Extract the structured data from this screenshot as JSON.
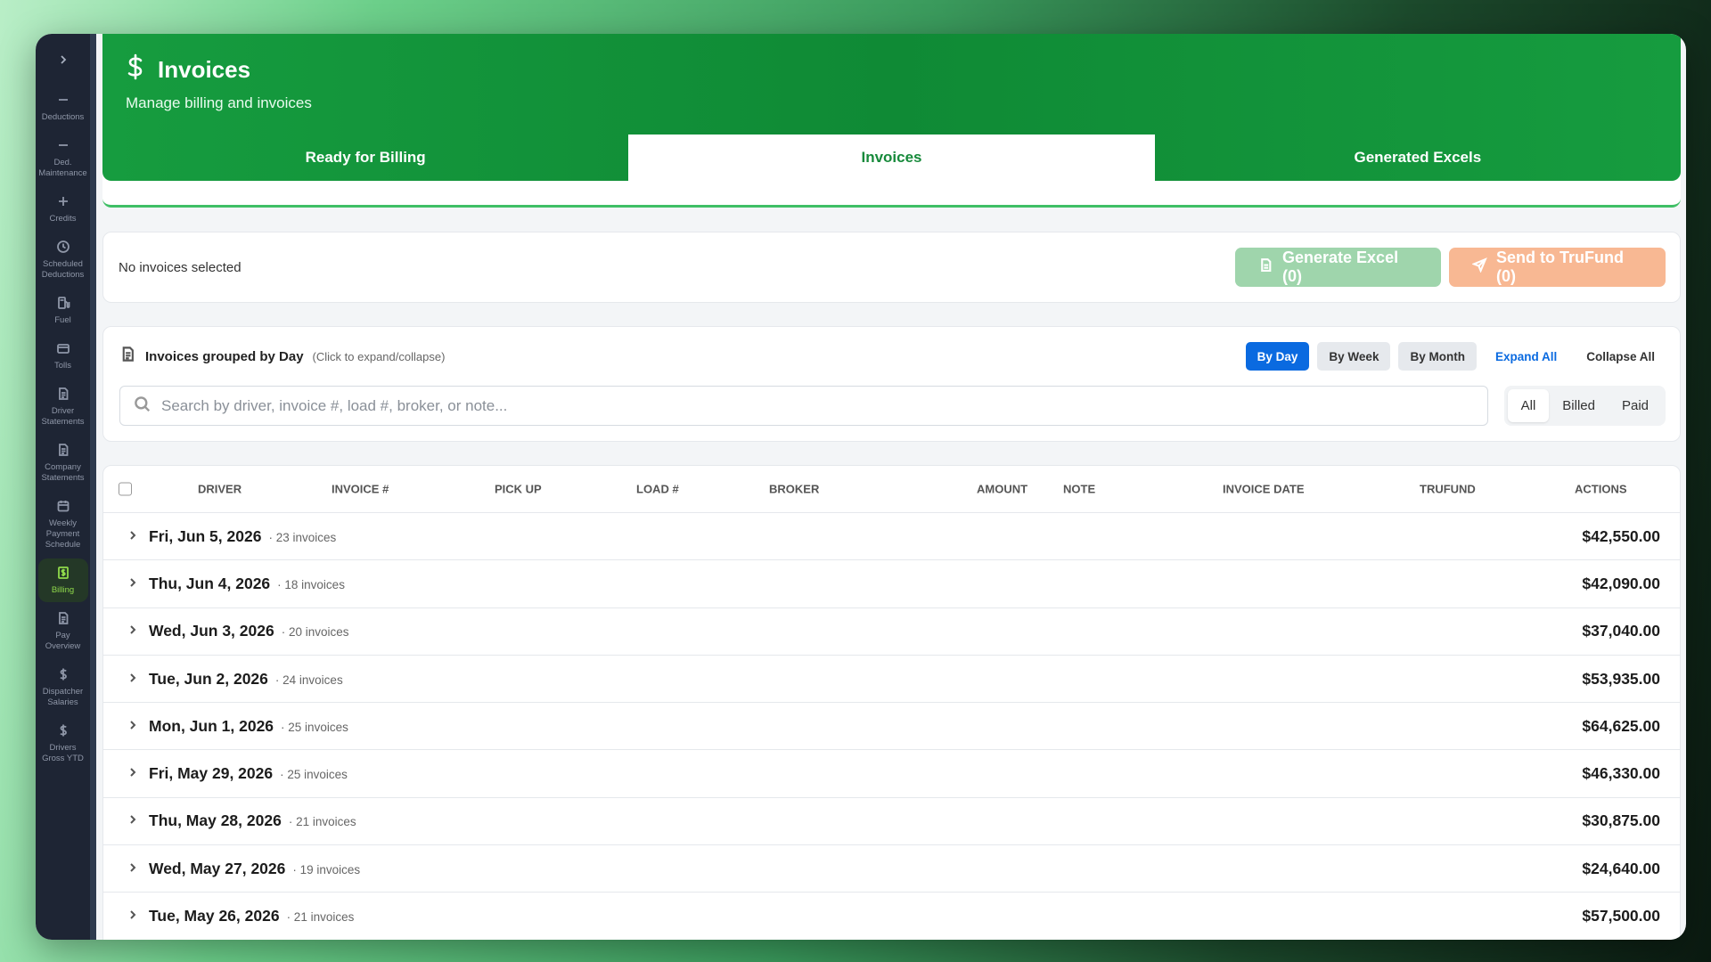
{
  "sidebar": {
    "items": [
      {
        "label": "Deductions",
        "icon": "minus-icon"
      },
      {
        "label": "Ded. Maintenance",
        "icon": "minus-icon"
      },
      {
        "label": "Credits",
        "icon": "plus-icon"
      },
      {
        "label": "Scheduled Deductions",
        "icon": "clock-icon"
      },
      {
        "label": "Fuel",
        "icon": "fuel-icon"
      },
      {
        "label": "Tolls",
        "icon": "card-icon"
      },
      {
        "label": "Driver Statements",
        "icon": "document-icon"
      },
      {
        "label": "Company Statements",
        "icon": "document-icon"
      },
      {
        "label": "Weekly Payment Schedule",
        "icon": "calendar-icon"
      },
      {
        "label": "Billing",
        "icon": "dollar-document-icon",
        "active": true
      },
      {
        "label": "Pay Overview",
        "icon": "document-icon"
      },
      {
        "label": "Dispatcher Salaries",
        "icon": "dollar-icon"
      },
      {
        "label": "Drivers Gross YTD",
        "icon": "dollar-icon"
      }
    ]
  },
  "header": {
    "title": "Invoices",
    "subtitle": "Manage billing and invoices",
    "tabs": [
      {
        "label": "Ready for Billing",
        "active": false
      },
      {
        "label": "Invoices",
        "active": true
      },
      {
        "label": "Generated Excels",
        "active": false
      }
    ]
  },
  "selection": {
    "status": "No invoices selected",
    "generate_excel": "Generate Excel (0)",
    "send_trufund": "Send to TruFund (0)"
  },
  "grouping": {
    "title": "Invoices grouped by Day",
    "hint": "(Click to expand/collapse)",
    "by_day": "By Day",
    "by_week": "By Week",
    "by_month": "By Month",
    "expand_all": "Expand All",
    "collapse_all": "Collapse All",
    "search_placeholder": "Search by driver, invoice #, load #, broker, or note...",
    "filters": [
      "All",
      "Billed",
      "Paid"
    ]
  },
  "table": {
    "columns": {
      "driver": "DRIVER",
      "invoice": "INVOICE #",
      "pickup": "PICK UP",
      "load": "LOAD #",
      "broker": "BROKER",
      "amount": "AMOUNT",
      "note": "NOTE",
      "invoice_date": "INVOICE DATE",
      "trufund": "TRUFUND",
      "actions": "ACTIONS"
    },
    "rows": [
      {
        "date": "Fri, Jun 5, 2026",
        "count": "· 23 invoices",
        "amount": "$42,550.00"
      },
      {
        "date": "Thu, Jun 4, 2026",
        "count": "· 18 invoices",
        "amount": "$42,090.00"
      },
      {
        "date": "Wed, Jun 3, 2026",
        "count": "· 20 invoices",
        "amount": "$37,040.00"
      },
      {
        "date": "Tue, Jun 2, 2026",
        "count": "· 24 invoices",
        "amount": "$53,935.00"
      },
      {
        "date": "Mon, Jun 1, 2026",
        "count": "· 25 invoices",
        "amount": "$64,625.00"
      },
      {
        "date": "Fri, May 29, 2026",
        "count": "· 25 invoices",
        "amount": "$46,330.00"
      },
      {
        "date": "Thu, May 28, 2026",
        "count": "· 21 invoices",
        "amount": "$30,875.00"
      },
      {
        "date": "Wed, May 27, 2026",
        "count": "· 19 invoices",
        "amount": "$24,640.00"
      },
      {
        "date": "Tue, May 26, 2026",
        "count": "· 21 invoices",
        "amount": "$57,500.00"
      }
    ]
  },
  "colors": {
    "header_green": "#169c3f",
    "active_blue": "#0a6ae0",
    "excel_button": "#9fd5ac",
    "trufund_button": "#f8b893",
    "sidebar_bg": "#1e2534",
    "sidebar_active": "#8fd94b"
  }
}
